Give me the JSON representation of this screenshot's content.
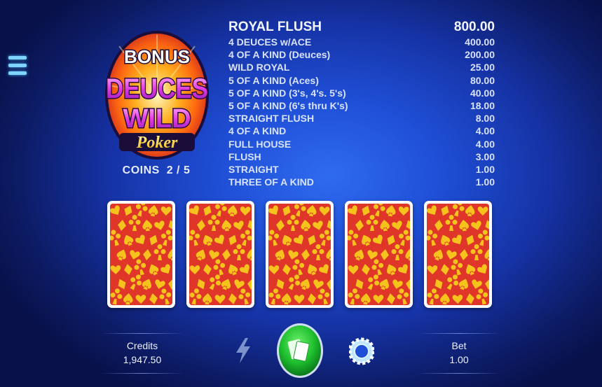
{
  "game": {
    "logo_lines": [
      "BONUS",
      "DEUCES",
      "WILD",
      "Poker"
    ],
    "coins_label": "COINS",
    "coins_value": "2 / 5"
  },
  "paytable": [
    {
      "hand": "ROYAL FLUSH",
      "payout": "800.00"
    },
    {
      "hand": "4 DEUCES w/ACE",
      "payout": "400.00"
    },
    {
      "hand": "4 OF A KIND (Deuces)",
      "payout": "200.00"
    },
    {
      "hand": "WILD ROYAL",
      "payout": "25.00"
    },
    {
      "hand": "5 OF A KIND (Aces)",
      "payout": "80.00"
    },
    {
      "hand": "5 OF A KIND (3's, 4's. 5's)",
      "payout": "40.00"
    },
    {
      "hand": "5 OF A KIND (6's thru K's)",
      "payout": "18.00"
    },
    {
      "hand": "STRAIGHT FLUSH",
      "payout": "8.00"
    },
    {
      "hand": "4 OF A KIND",
      "payout": "4.00"
    },
    {
      "hand": "FULL HOUSE",
      "payout": "4.00"
    },
    {
      "hand": "FLUSH",
      "payout": "3.00"
    },
    {
      "hand": "STRAIGHT",
      "payout": "1.00"
    },
    {
      "hand": "THREE OF A KIND",
      "payout": "1.00"
    }
  ],
  "cards": [
    {
      "state": "face-down"
    },
    {
      "state": "face-down"
    },
    {
      "state": "face-down"
    },
    {
      "state": "face-down"
    },
    {
      "state": "face-down"
    }
  ],
  "footer": {
    "credits_label": "Credits",
    "credits_value": "1,947.50",
    "bet_label": "Bet",
    "bet_value": "1.00"
  },
  "icons": {
    "menu": "hamburger-menu-icon",
    "turbo": "lightning-icon",
    "deal": "cards-icon",
    "chip": "chip-icon"
  },
  "colors": {
    "card_back": "#e0362a",
    "card_pattern": "#f6c21c",
    "deal_button": "#1fbf2f",
    "chip": "#bfe6ff"
  }
}
